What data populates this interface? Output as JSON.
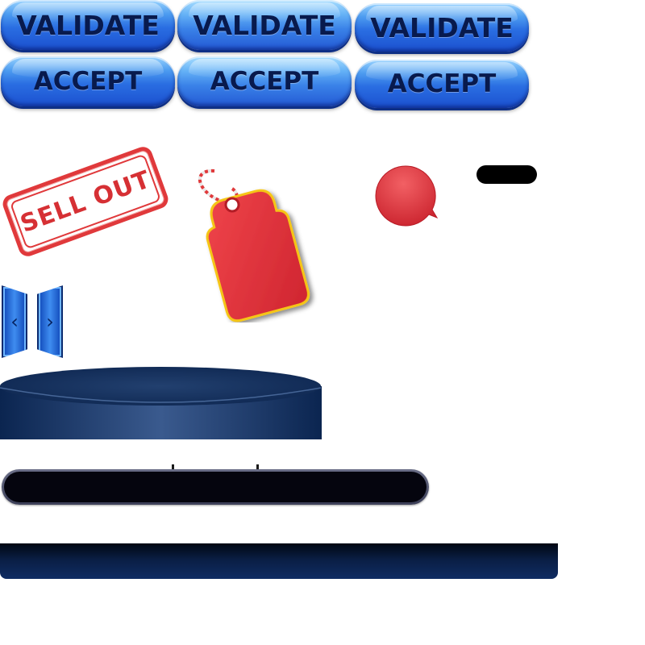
{
  "buttons": {
    "validate": [
      "VALIDATE",
      "VALIDATE",
      "VALIDATE"
    ],
    "accept": [
      "ACCEPT",
      "ACCEPT",
      "ACCEPT"
    ]
  },
  "stamp": {
    "text": "SELL OUT",
    "color": "#e0393b"
  },
  "tag": {
    "color": "#e53339",
    "string_color": "#e0393b"
  },
  "bubble": {
    "color": "#e2313a"
  },
  "arrows": {
    "left": "‹",
    "right": "›"
  },
  "colors": {
    "button_blue": "#2a6ee2",
    "button_text": "#081a4d",
    "navy": "#0f2c63"
  }
}
